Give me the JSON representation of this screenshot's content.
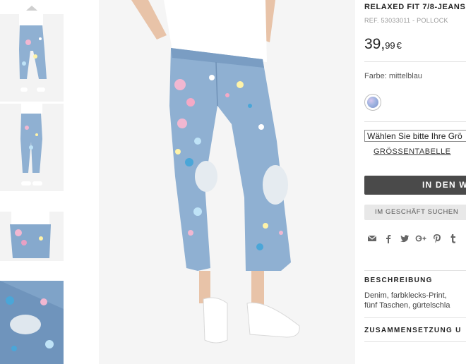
{
  "product": {
    "title": "RELAXED FIT 7/8-JEANS",
    "reference": "REF. 53033011 - POLLOCK",
    "price_int": "39,",
    "price_dec": "99",
    "currency": "€",
    "color_label": "Farbe: mittelblau",
    "size_select_placeholder": "Wählen Sie bitte Ihre Grö",
    "size_table_link": "GRÖSSENTABELLE",
    "add_to_cart": "IN DEN W",
    "store_search": "IM GESCHÄFT SUCHEN",
    "description_heading": "BESCHREIBUNG",
    "description_line1": "Denim, farbklecks-Print,",
    "description_line2": "fünf Taschen, gürtelschla",
    "composition_heading": "ZUSAMMENSETZUNG U"
  },
  "share_icons": [
    "mail-icon",
    "facebook-icon",
    "twitter-icon",
    "google-plus-icon",
    "pinterest-icon",
    "tumblr-icon"
  ],
  "colors": {
    "denim": "#8fb0d2",
    "button_dark": "#4a4a4a",
    "button_light": "#e8e8e8"
  }
}
